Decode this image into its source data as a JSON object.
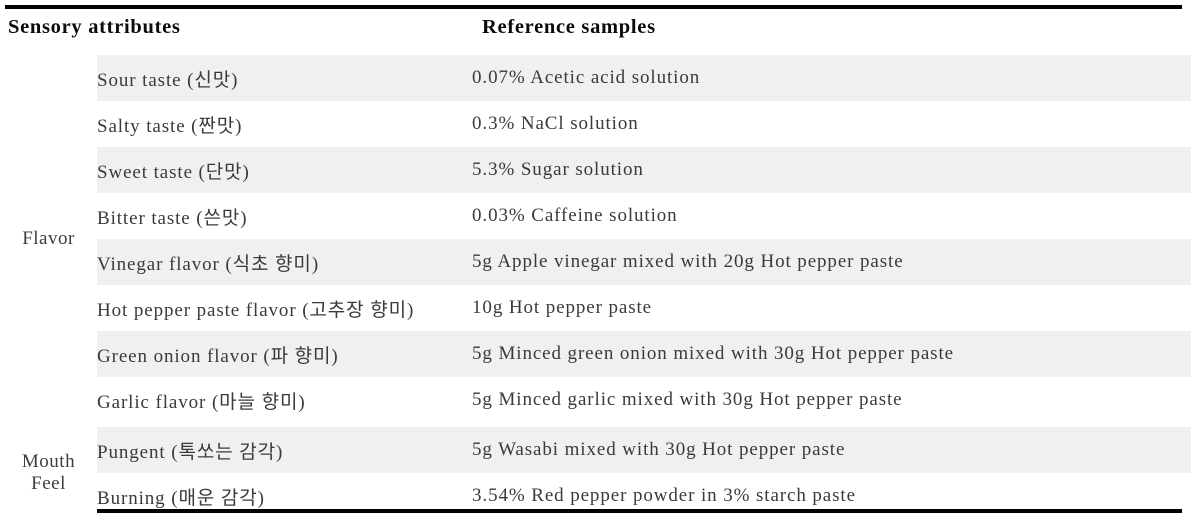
{
  "table": {
    "header": {
      "attributes_label": "Sensory attributes",
      "reference_label": "Reference samples"
    },
    "groups": [
      {
        "label": "Flavor",
        "rows": [
          {
            "attribute": "Sour taste (신맛)",
            "reference": "0.07% Acetic acid solution"
          },
          {
            "attribute": "Salty taste (짠맛)",
            "reference": "0.3% NaCl solution"
          },
          {
            "attribute": "Sweet taste (단맛)",
            "reference": "5.3% Sugar solution"
          },
          {
            "attribute": "Bitter taste (쓴맛)",
            "reference": "0.03% Caffeine solution"
          },
          {
            "attribute": "Vinegar flavor (식초 향미)",
            "reference": "5g Apple vinegar mixed with 20g Hot pepper paste"
          },
          {
            "attribute": "Hot pepper paste flavor (고추장 향미)",
            "reference": "10g Hot pepper paste"
          },
          {
            "attribute": "Green onion flavor (파 향미)",
            "reference": "5g Minced green onion mixed with 30g Hot pepper paste"
          },
          {
            "attribute": "Garlic flavor (마늘 향미)",
            "reference": "5g Minced garlic mixed with 30g Hot pepper paste"
          }
        ]
      },
      {
        "label": "Mouth Feel",
        "label_line1": "Mouth",
        "label_line2": "Feel",
        "rows": [
          {
            "attribute": "Pungent (톡쏘는 감각)",
            "reference": "5g Wasabi mixed with 30g Hot pepper paste"
          },
          {
            "attribute": "Burning (매운 감각)",
            "reference": "3.54% Red pepper powder in 3% starch paste"
          }
        ]
      }
    ]
  },
  "style": {
    "rule_color": "#000000",
    "stripe_color": "#f0f0f0",
    "header_text_color": "#0b0b0b",
    "body_text_color": "#3a3a3a"
  }
}
